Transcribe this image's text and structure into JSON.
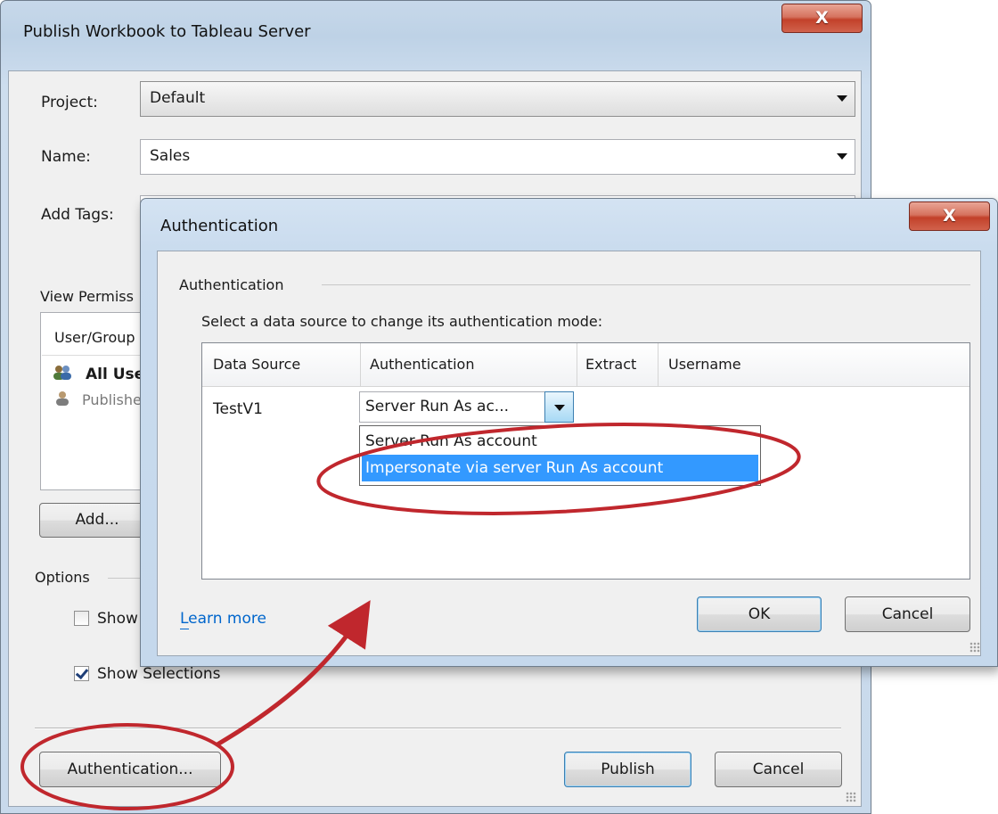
{
  "publish_dialog": {
    "title": "Publish Workbook to Tableau Server",
    "close_glyph": "X",
    "project_label": "Project:",
    "project_value": "Default",
    "name_label": "Name:",
    "name_value": "Sales",
    "tags_label": "Add Tags:",
    "tags_value": "",
    "permissions_label": "View Permiss",
    "permissions_list": {
      "header": "User/Group",
      "rows": [
        {
          "label": "All Use",
          "icon": "users-icon",
          "bold": true
        },
        {
          "label": "Publishe",
          "icon": "user-icon",
          "bold": false
        }
      ]
    },
    "add_button": "Add...",
    "options_label": "Options",
    "option_show_sheets": {
      "label": "Show",
      "checked": false
    },
    "option_show_selections": {
      "label": "Show Selections",
      "checked": true
    },
    "authentication_button": "Authentication...",
    "publish_button": "Publish",
    "cancel_button": "Cancel"
  },
  "auth_dialog": {
    "title": "Authentication",
    "close_glyph": "X",
    "group_label": "Authentication",
    "instruction": "Select a data source to change its authentication mode:",
    "columns": [
      "Data Source",
      "Authentication",
      "Extract",
      "Username"
    ],
    "row": {
      "data_source": "TestV1",
      "authentication": "Server Run As ac...",
      "extract": "",
      "username": ""
    },
    "dropdown_options": [
      {
        "label": "Server Run As account",
        "selected": false
      },
      {
        "label": "Impersonate via server Run As account",
        "selected": true
      }
    ],
    "learn_more": "Learn more",
    "ok_button": "OK",
    "cancel_button": "Cancel"
  },
  "annotations": {
    "color": "#c0272d"
  }
}
